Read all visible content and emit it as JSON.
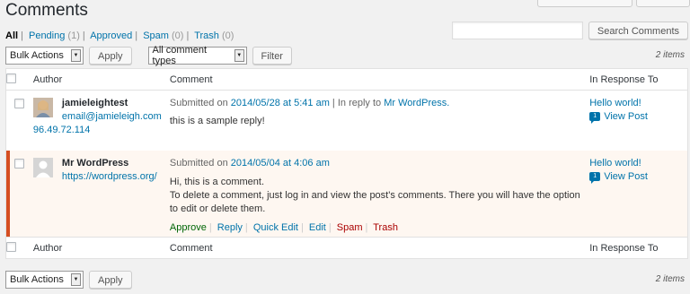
{
  "title": "Comments",
  "views": [
    {
      "label": "All",
      "count": ""
    },
    {
      "label": "Pending",
      "count": "(1)"
    },
    {
      "label": "Approved",
      "count": ""
    },
    {
      "label": "Spam",
      "count": "(0)"
    },
    {
      "label": "Trash",
      "count": "(0)"
    }
  ],
  "search": {
    "button": "Search Comments",
    "placeholder": ""
  },
  "bulk": {
    "label": "Bulk Actions",
    "apply": "Apply"
  },
  "filter": {
    "type": "All comment types",
    "button": "Filter"
  },
  "items_count": "2 items",
  "columns": {
    "author": "Author",
    "comment": "Comment",
    "response": "In Response To"
  },
  "comments": [
    {
      "author": "jamieleightest",
      "email": "email@jamieleigh.com",
      "ip": "96.49.72.114",
      "submitted_prefix": "Submitted on",
      "date": "2014/05/28 at 5:41 am",
      "reply_prefix": "| In reply to",
      "reply_to": "Mr WordPress.",
      "text": "this is a sample reply!",
      "response_title": "Hello world!",
      "response_count": "1",
      "view_post": "View Post"
    },
    {
      "author": "Mr WordPress",
      "url": "https://wordpress.org/",
      "submitted_prefix": "Submitted on",
      "date": "2014/05/04 at 4:06 am",
      "text1": "Hi, this is a comment.",
      "text2": "To delete a comment, just log in and view the post's comments. There you will have the option to edit or delete them.",
      "actions": [
        "Approve",
        "Reply",
        "Quick Edit",
        "Edit",
        "Spam",
        "Trash"
      ],
      "response_title": "Hello world!",
      "response_count": "1",
      "view_post": "View Post"
    }
  ]
}
